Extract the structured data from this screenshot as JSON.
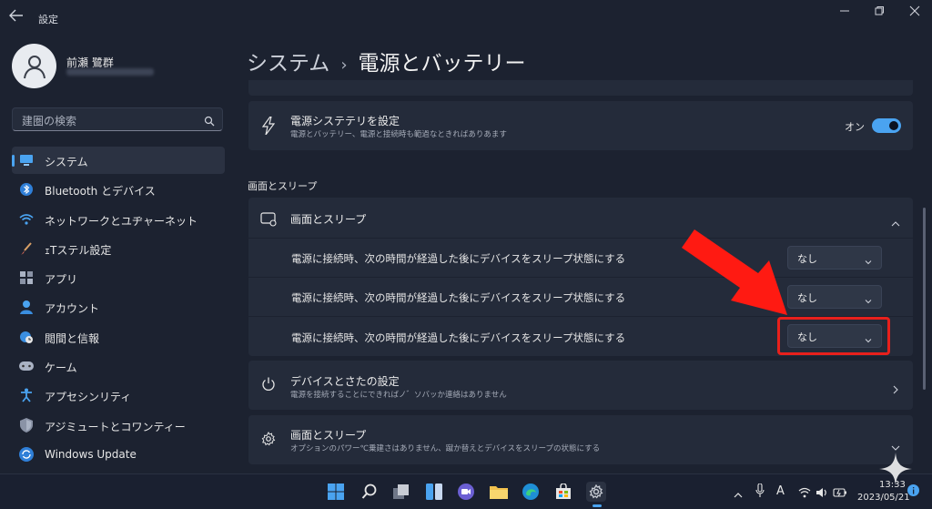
{
  "window": {
    "title": "設定"
  },
  "profile": {
    "name": "前瀬 鷺群"
  },
  "search": {
    "placeholder": "建圏の検索"
  },
  "sidebar": {
    "items": [
      {
        "label": "システム",
        "icon": "monitor-icon",
        "active": true
      },
      {
        "label": "Bluetooth とデバイス",
        "icon": "bluetooth-icon"
      },
      {
        "label": "ネットワークとユヂャーネット",
        "icon": "wifi-icon"
      },
      {
        "label": "ｪTステル設定",
        "icon": "brush-icon"
      },
      {
        "label": "アプリ",
        "icon": "apps-icon"
      },
      {
        "label": "アカウント",
        "icon": "person-icon"
      },
      {
        "label": "閲間と信報",
        "icon": "globe-clock-icon"
      },
      {
        "label": "ケーム",
        "icon": "gamepad-icon"
      },
      {
        "label": "アプセシンリティ",
        "icon": "accessibility-icon"
      },
      {
        "label": "アジミュートとコワンティー",
        "icon": "shield-icon"
      },
      {
        "label": "Windows Update",
        "icon": "update-icon"
      }
    ]
  },
  "header": {
    "breadcrumb_root": "システム",
    "separator": "›",
    "page_title": "電源とバッテリー"
  },
  "energy_card": {
    "title": "電源システテリを設定",
    "subtitle": "電源とバッテリー、電源と接続時も範過なときればありあます",
    "toggle_label": "オン",
    "toggle_on": true
  },
  "section": {
    "heading": "画面とスリープ"
  },
  "screen_sleep": {
    "title": "画面とスリープ",
    "rows": [
      {
        "label": "電源に接続時、次の時間が経過した後にデバイスをスリープ状態にする",
        "value": "なし"
      },
      {
        "label": "電源に接続時、次の時間が経過した後にデバイスをスリープ状態にする",
        "value": "なし"
      },
      {
        "label": "電源に接続時、次の時間が経過した後にデバイスをスリープ状態にする",
        "value": "なし"
      }
    ]
  },
  "device_card": {
    "title": "デバイスとさたの設定",
    "subtitle": "電源を接続することにできればノ゛ソバッか連絡はありません"
  },
  "sleep_card": {
    "title": "画面とスリープ",
    "subtitle": "オプションのパワー℃乗建さはありません、蹴か替えとデバイスをスリープの状態にする"
  },
  "taskbar": {
    "tray_letter": "A",
    "time": "13:33",
    "date": "2023/05/21"
  },
  "colors": {
    "accent": "#4aa3f0",
    "highlight": "#e8201c",
    "arrow": "#ff1a12"
  }
}
